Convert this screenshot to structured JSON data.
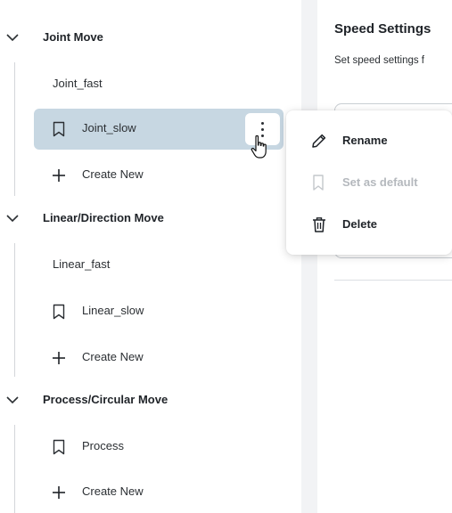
{
  "sidebar": {
    "groups": [
      {
        "title": "Joint Move",
        "items": [
          {
            "label": "Joint_fast",
            "icon": "none"
          },
          {
            "label": "Joint_slow",
            "icon": "bookmark-icon",
            "selected": true
          },
          {
            "label": "Create New",
            "icon": "plus-icon"
          }
        ]
      },
      {
        "title": "Linear/Direction Move",
        "items": [
          {
            "label": "Linear_fast",
            "icon": "none"
          },
          {
            "label": "Linear_slow",
            "icon": "bookmark-icon"
          },
          {
            "label": "Create New",
            "icon": "plus-icon"
          }
        ]
      },
      {
        "title": "Process/Circular Move",
        "items": [
          {
            "label": "Process",
            "icon": "bookmark-icon"
          },
          {
            "label": "Create New",
            "icon": "plus-icon"
          }
        ]
      }
    ]
  },
  "context_menu": {
    "items": [
      {
        "label": "Rename",
        "icon": "pencil-icon",
        "enabled": true
      },
      {
        "label": "Set as default",
        "icon": "bookmark-icon",
        "enabled": false
      },
      {
        "label": "Delete",
        "icon": "trash-icon",
        "enabled": true
      }
    ]
  },
  "main": {
    "title": "Speed Settings",
    "subtitle": "Set speed settings f"
  },
  "colors": {
    "selected_background": "#c7d7e2",
    "disabled_text": "#b4b8bd",
    "panel_divider": "#f2f3f5"
  }
}
